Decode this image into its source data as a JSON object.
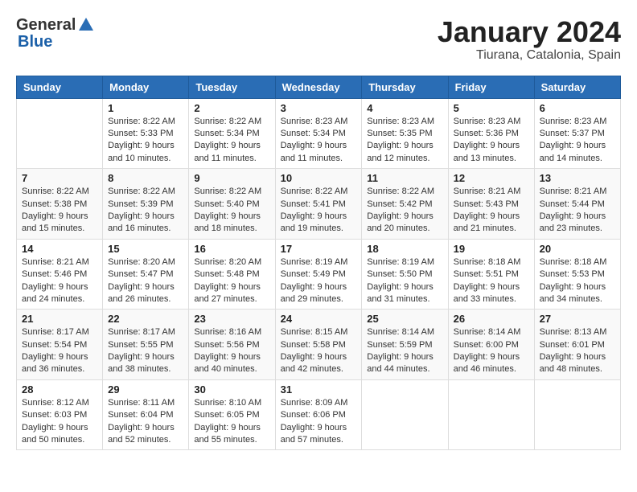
{
  "logo": {
    "general": "General",
    "blue": "Blue"
  },
  "header": {
    "month": "January 2024",
    "location": "Tiurana, Catalonia, Spain"
  },
  "weekdays": [
    "Sunday",
    "Monday",
    "Tuesday",
    "Wednesday",
    "Thursday",
    "Friday",
    "Saturday"
  ],
  "weeks": [
    [
      {
        "day": "",
        "sunrise": "",
        "sunset": "",
        "daylight": ""
      },
      {
        "day": "1",
        "sunrise": "Sunrise: 8:22 AM",
        "sunset": "Sunset: 5:33 PM",
        "daylight": "Daylight: 9 hours and 10 minutes."
      },
      {
        "day": "2",
        "sunrise": "Sunrise: 8:22 AM",
        "sunset": "Sunset: 5:34 PM",
        "daylight": "Daylight: 9 hours and 11 minutes."
      },
      {
        "day": "3",
        "sunrise": "Sunrise: 8:23 AM",
        "sunset": "Sunset: 5:34 PM",
        "daylight": "Daylight: 9 hours and 11 minutes."
      },
      {
        "day": "4",
        "sunrise": "Sunrise: 8:23 AM",
        "sunset": "Sunset: 5:35 PM",
        "daylight": "Daylight: 9 hours and 12 minutes."
      },
      {
        "day": "5",
        "sunrise": "Sunrise: 8:23 AM",
        "sunset": "Sunset: 5:36 PM",
        "daylight": "Daylight: 9 hours and 13 minutes."
      },
      {
        "day": "6",
        "sunrise": "Sunrise: 8:23 AM",
        "sunset": "Sunset: 5:37 PM",
        "daylight": "Daylight: 9 hours and 14 minutes."
      }
    ],
    [
      {
        "day": "7",
        "sunrise": "Sunrise: 8:22 AM",
        "sunset": "Sunset: 5:38 PM",
        "daylight": "Daylight: 9 hours and 15 minutes."
      },
      {
        "day": "8",
        "sunrise": "Sunrise: 8:22 AM",
        "sunset": "Sunset: 5:39 PM",
        "daylight": "Daylight: 9 hours and 16 minutes."
      },
      {
        "day": "9",
        "sunrise": "Sunrise: 8:22 AM",
        "sunset": "Sunset: 5:40 PM",
        "daylight": "Daylight: 9 hours and 18 minutes."
      },
      {
        "day": "10",
        "sunrise": "Sunrise: 8:22 AM",
        "sunset": "Sunset: 5:41 PM",
        "daylight": "Daylight: 9 hours and 19 minutes."
      },
      {
        "day": "11",
        "sunrise": "Sunrise: 8:22 AM",
        "sunset": "Sunset: 5:42 PM",
        "daylight": "Daylight: 9 hours and 20 minutes."
      },
      {
        "day": "12",
        "sunrise": "Sunrise: 8:21 AM",
        "sunset": "Sunset: 5:43 PM",
        "daylight": "Daylight: 9 hours and 21 minutes."
      },
      {
        "day": "13",
        "sunrise": "Sunrise: 8:21 AM",
        "sunset": "Sunset: 5:44 PM",
        "daylight": "Daylight: 9 hours and 23 minutes."
      }
    ],
    [
      {
        "day": "14",
        "sunrise": "Sunrise: 8:21 AM",
        "sunset": "Sunset: 5:46 PM",
        "daylight": "Daylight: 9 hours and 24 minutes."
      },
      {
        "day": "15",
        "sunrise": "Sunrise: 8:20 AM",
        "sunset": "Sunset: 5:47 PM",
        "daylight": "Daylight: 9 hours and 26 minutes."
      },
      {
        "day": "16",
        "sunrise": "Sunrise: 8:20 AM",
        "sunset": "Sunset: 5:48 PM",
        "daylight": "Daylight: 9 hours and 27 minutes."
      },
      {
        "day": "17",
        "sunrise": "Sunrise: 8:19 AM",
        "sunset": "Sunset: 5:49 PM",
        "daylight": "Daylight: 9 hours and 29 minutes."
      },
      {
        "day": "18",
        "sunrise": "Sunrise: 8:19 AM",
        "sunset": "Sunset: 5:50 PM",
        "daylight": "Daylight: 9 hours and 31 minutes."
      },
      {
        "day": "19",
        "sunrise": "Sunrise: 8:18 AM",
        "sunset": "Sunset: 5:51 PM",
        "daylight": "Daylight: 9 hours and 33 minutes."
      },
      {
        "day": "20",
        "sunrise": "Sunrise: 8:18 AM",
        "sunset": "Sunset: 5:53 PM",
        "daylight": "Daylight: 9 hours and 34 minutes."
      }
    ],
    [
      {
        "day": "21",
        "sunrise": "Sunrise: 8:17 AM",
        "sunset": "Sunset: 5:54 PM",
        "daylight": "Daylight: 9 hours and 36 minutes."
      },
      {
        "day": "22",
        "sunrise": "Sunrise: 8:17 AM",
        "sunset": "Sunset: 5:55 PM",
        "daylight": "Daylight: 9 hours and 38 minutes."
      },
      {
        "day": "23",
        "sunrise": "Sunrise: 8:16 AM",
        "sunset": "Sunset: 5:56 PM",
        "daylight": "Daylight: 9 hours and 40 minutes."
      },
      {
        "day": "24",
        "sunrise": "Sunrise: 8:15 AM",
        "sunset": "Sunset: 5:58 PM",
        "daylight": "Daylight: 9 hours and 42 minutes."
      },
      {
        "day": "25",
        "sunrise": "Sunrise: 8:14 AM",
        "sunset": "Sunset: 5:59 PM",
        "daylight": "Daylight: 9 hours and 44 minutes."
      },
      {
        "day": "26",
        "sunrise": "Sunrise: 8:14 AM",
        "sunset": "Sunset: 6:00 PM",
        "daylight": "Daylight: 9 hours and 46 minutes."
      },
      {
        "day": "27",
        "sunrise": "Sunrise: 8:13 AM",
        "sunset": "Sunset: 6:01 PM",
        "daylight": "Daylight: 9 hours and 48 minutes."
      }
    ],
    [
      {
        "day": "28",
        "sunrise": "Sunrise: 8:12 AM",
        "sunset": "Sunset: 6:03 PM",
        "daylight": "Daylight: 9 hours and 50 minutes."
      },
      {
        "day": "29",
        "sunrise": "Sunrise: 8:11 AM",
        "sunset": "Sunset: 6:04 PM",
        "daylight": "Daylight: 9 hours and 52 minutes."
      },
      {
        "day": "30",
        "sunrise": "Sunrise: 8:10 AM",
        "sunset": "Sunset: 6:05 PM",
        "daylight": "Daylight: 9 hours and 55 minutes."
      },
      {
        "day": "31",
        "sunrise": "Sunrise: 8:09 AM",
        "sunset": "Sunset: 6:06 PM",
        "daylight": "Daylight: 9 hours and 57 minutes."
      },
      {
        "day": "",
        "sunrise": "",
        "sunset": "",
        "daylight": ""
      },
      {
        "day": "",
        "sunrise": "",
        "sunset": "",
        "daylight": ""
      },
      {
        "day": "",
        "sunrise": "",
        "sunset": "",
        "daylight": ""
      }
    ]
  ]
}
